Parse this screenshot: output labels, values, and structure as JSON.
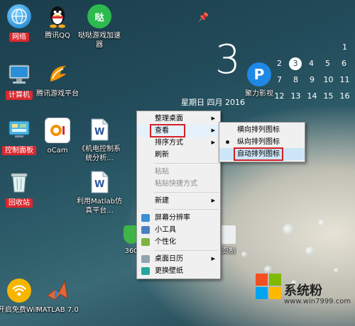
{
  "desktop_icons": [
    {
      "id": "network",
      "label": "网络",
      "icon": "network-globe-icon"
    },
    {
      "id": "qq",
      "label": "腾讯QQ",
      "icon": "qq-penguin-icon"
    },
    {
      "id": "game-accel",
      "label": "哒哒游戏加速器",
      "icon": "game-accelerator-icon"
    },
    {
      "id": "computer",
      "label": "计算机",
      "icon": "computer-monitor-icon"
    },
    {
      "id": "tencent-games",
      "label": "腾讯游戏平台",
      "icon": "tencent-games-icon"
    },
    {
      "id": "control-panel",
      "label": "控制面板",
      "icon": "control-panel-icon"
    },
    {
      "id": "ocam",
      "label": "oCam",
      "icon": "ocam-icon"
    },
    {
      "id": "doc",
      "label": "《机电控制系统分析...",
      "icon": "word-document-icon"
    },
    {
      "id": "recycle",
      "label": "回收站",
      "icon": "recycle-bin-icon"
    },
    {
      "id": "matlab-doc",
      "label": "利用Matlab仿真平台...",
      "icon": "word-document-icon"
    },
    {
      "id": "wifi",
      "label": "开启免费WiFi",
      "icon": "free-wifi-icon"
    },
    {
      "id": "matlab",
      "label": "MATLAB 7.0",
      "icon": "matlab-icon"
    },
    {
      "id": "360",
      "label": "360",
      "icon": "shield-360-icon"
    },
    {
      "id": "video",
      "label": "聚力影视",
      "icon": "pptv-icon"
    },
    {
      "id": "page-label",
      "label": "页制",
      "icon": "document-icon"
    }
  ],
  "clock_widget": {
    "day": "3",
    "date_text": "星期日  四月  2016",
    "calendar_days": [
      "",
      "",
      "",
      "",
      "1",
      "2",
      "3",
      "4",
      "5",
      "6",
      "7",
      "8",
      "9",
      "10",
      "11",
      "12",
      "13",
      "14",
      "15",
      "16"
    ],
    "today": "3"
  },
  "context_menu": {
    "items": [
      {
        "label": "整理桌面",
        "submenu": true
      },
      {
        "label": "查看",
        "submenu": true,
        "highlighted": true
      },
      {
        "label": "排序方式",
        "submenu": true
      },
      {
        "label": "刷新"
      },
      {
        "separator": true
      },
      {
        "label": "粘贴",
        "disabled": true
      },
      {
        "label": "粘贴快捷方式",
        "disabled": true
      },
      {
        "separator": true
      },
      {
        "label": "新建",
        "submenu": true
      },
      {
        "separator": true
      },
      {
        "label": "屏幕分辨率",
        "icon": "display-icon"
      },
      {
        "label": "小工具",
        "icon": "gadgets-icon"
      },
      {
        "label": "个性化",
        "icon": "personalize-icon"
      },
      {
        "separator": true
      },
      {
        "label": "桌面日历",
        "submenu": true,
        "icon": "calendar-icon"
      },
      {
        "label": "更换壁纸",
        "icon": "wallpaper-icon"
      }
    ]
  },
  "view_submenu": {
    "items": [
      {
        "label": "横向排列图标"
      },
      {
        "label": "纵向排列图标",
        "radio": true
      },
      {
        "label": "自动排列图标",
        "highlighted": true
      }
    ]
  },
  "watermark": {
    "text": "系统粉",
    "url": "www.win7999.com",
    "colors": [
      "#f25022",
      "#7fba00",
      "#00a4ef",
      "#ffb900"
    ]
  }
}
